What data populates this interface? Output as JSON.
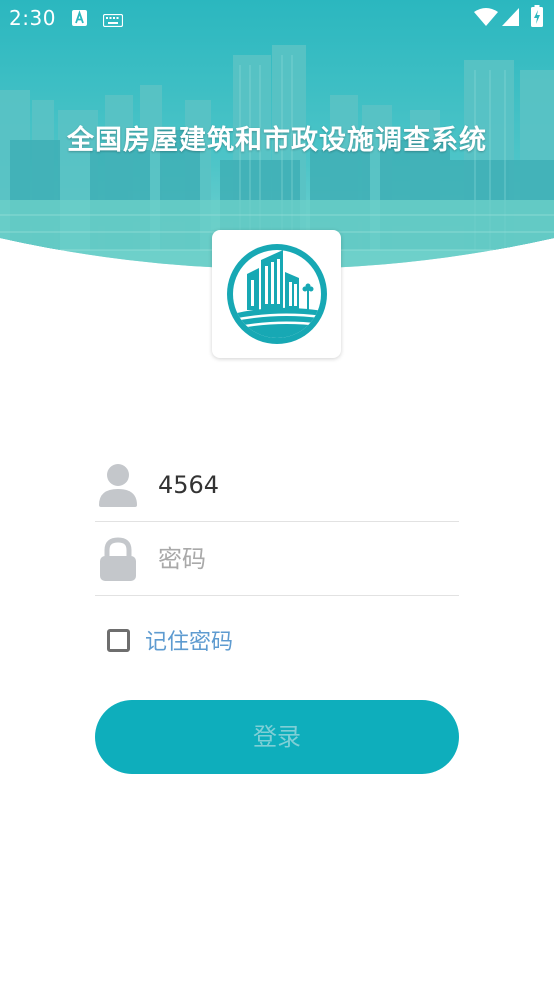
{
  "status_bar": {
    "time": "2:30",
    "icons": [
      "a-notification-icon",
      "keyboard-icon",
      "wifi-icon",
      "signal-icon",
      "battery-charging-icon"
    ]
  },
  "header": {
    "title": "全国房屋建筑和市政设施调查系统",
    "background_icon": "city-skyline-image"
  },
  "logo": {
    "icon": "building-logo-icon",
    "color": "#17a8b4"
  },
  "form": {
    "username": {
      "value": "4564",
      "placeholder": "",
      "icon": "user-icon"
    },
    "password": {
      "value": "",
      "placeholder": "密码",
      "icon": "lock-icon"
    },
    "remember": {
      "label": "记住密码",
      "checked": false
    },
    "login_label": "登录"
  },
  "colors": {
    "accent": "#0eaebc",
    "link": "#5e9bd0",
    "icon_gray": "#c4c7cb"
  }
}
